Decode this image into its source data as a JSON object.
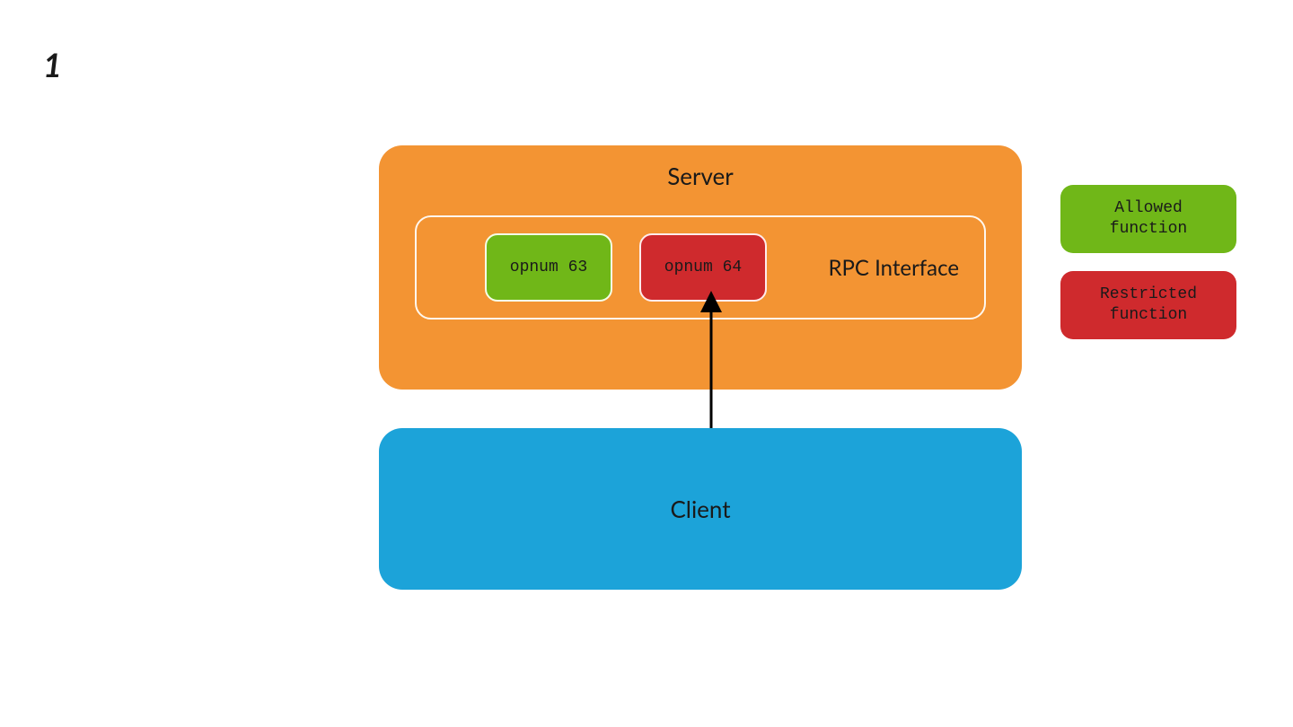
{
  "page_number": "1",
  "server": {
    "title": "Server",
    "rpc_interface_label": "RPC Interface",
    "opnums": {
      "allowed": "opnum 63",
      "restricted": "opnum 64"
    }
  },
  "client": {
    "title": "Client"
  },
  "legend": {
    "allowed": {
      "line1": "Allowed",
      "line2": "function"
    },
    "restricted": {
      "line1": "Restricted",
      "line2": "function"
    }
  },
  "colors": {
    "server_bg": "#f39433",
    "client_bg": "#1ca3d9",
    "allowed_bg": "#70b718",
    "restricted_bg": "#cf2a2d"
  }
}
